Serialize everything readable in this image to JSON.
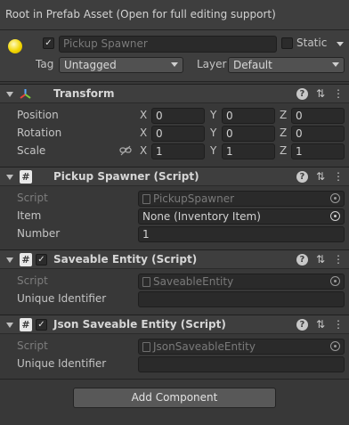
{
  "banner": {
    "text": "Root in Prefab Asset (Open for full editing support)"
  },
  "header": {
    "name": "Pickup Spawner",
    "active_check": "✓",
    "static_label": "Static",
    "tag_label": "Tag",
    "tag_value": "Untagged",
    "layer_label": "Layer",
    "layer_value": "Default"
  },
  "transform": {
    "title": "Transform",
    "rows": [
      {
        "label": "Position",
        "x": "0",
        "y": "0",
        "z": "0"
      },
      {
        "label": "Rotation",
        "x": "0",
        "y": "0",
        "z": "0"
      },
      {
        "label": "Scale",
        "x": "1",
        "y": "1",
        "z": "1"
      }
    ],
    "axis": {
      "x": "X",
      "y": "Y",
      "z": "Z"
    }
  },
  "pickup_spawner": {
    "title": "Pickup Spawner (Script)",
    "script_label": "Script",
    "script_value": "PickupSpawner",
    "item_label": "Item",
    "item_value": "None (Inventory Item)",
    "number_label": "Number",
    "number_value": "1"
  },
  "saveable_entity": {
    "title": "Saveable Entity (Script)",
    "script_label": "Script",
    "script_value": "SaveableEntity",
    "uid_label": "Unique Identifier",
    "uid_value": ""
  },
  "json_saveable_entity": {
    "title": "Json Saveable Entity (Script)",
    "script_label": "Script",
    "script_value": "JsonSaveableEntity",
    "uid_label": "Unique Identifier",
    "uid_value": ""
  },
  "add_component": {
    "label": "Add Component"
  },
  "icons": {
    "help": "?",
    "settings": "⇅",
    "more": "⋮",
    "check": "✓",
    "script": "#"
  },
  "colors": {
    "background": "#383838",
    "header": "#3e3e3e",
    "field": "#2a2a2a",
    "text": "#c4c4c4",
    "gameobject_icon": "#f2d600"
  }
}
